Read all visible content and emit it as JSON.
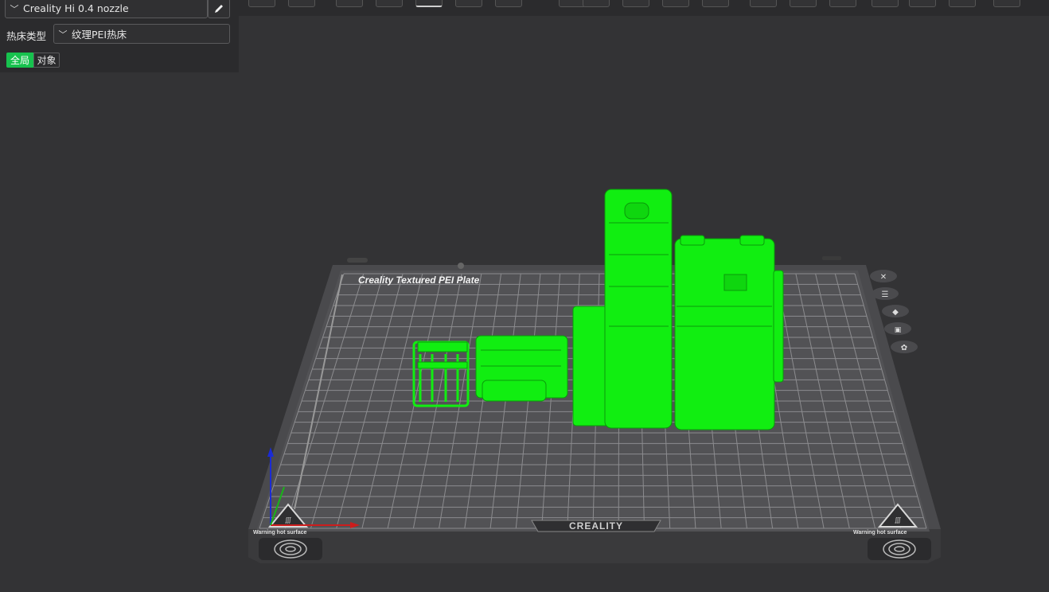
{
  "printer": {
    "selected": "Creality Hi 0.4 nozzle"
  },
  "bed": {
    "label": "热床类型",
    "selected": "纹理PEI热床"
  },
  "tabs": {
    "global": "全局",
    "object": "对象"
  },
  "plate": {
    "title": "Creality Textured PEI Plate",
    "brand": "CREALITY",
    "warning_left": "Warning hot surface",
    "warning_right": "Warning hot surface"
  },
  "toolbar": {
    "icons": [
      "add-icon",
      "plate-icon",
      "orient-icon",
      "arrange-icon",
      "move-icon",
      "rotate-icon",
      "scale-icon",
      "cut-icon",
      "support-icon",
      "seam-icon",
      "color-icon",
      "measure-icon",
      "text-icon",
      "assembly-icon",
      "layers-icon",
      "search-icon",
      "view-icon",
      "settings-icon",
      "preview-icon"
    ]
  },
  "colors": {
    "accent": "#17c24e",
    "model": "#11ee11",
    "background": "#333335"
  },
  "side_tools": [
    "close-icon",
    "list-icon",
    "view-3d-icon",
    "lock-icon",
    "settings-gear-icon"
  ]
}
